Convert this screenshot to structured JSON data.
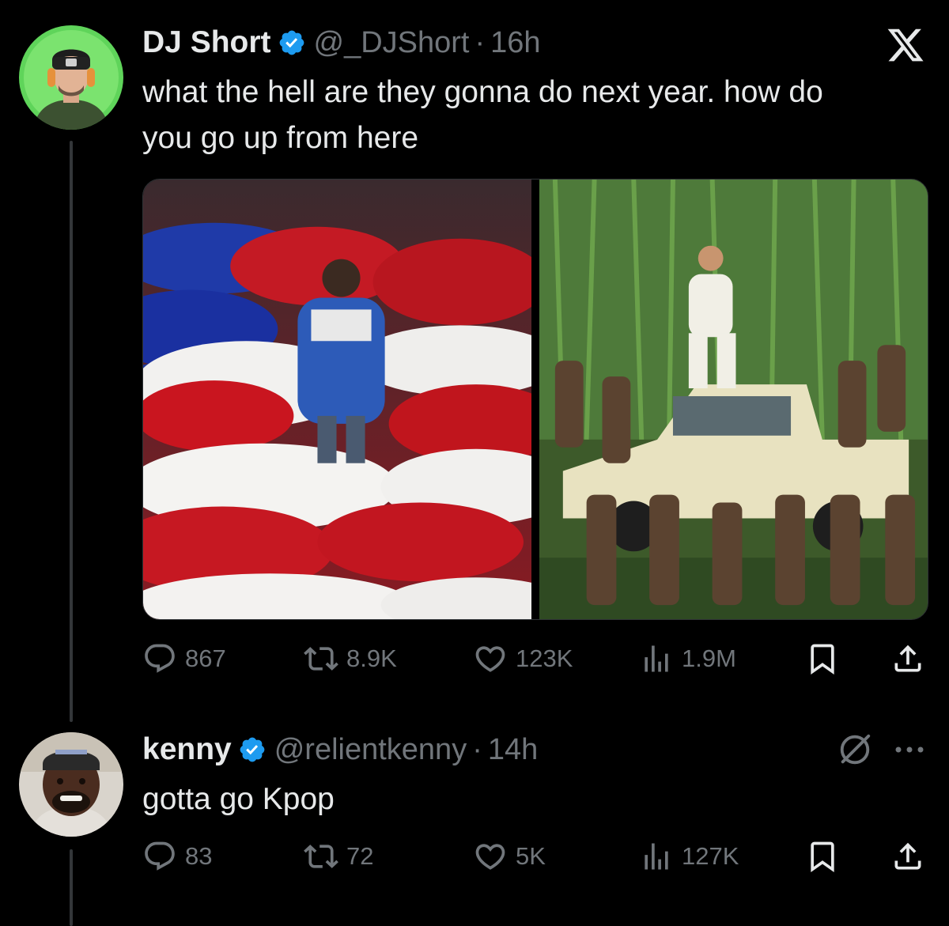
{
  "tweet": {
    "name": "DJ Short",
    "handle": "@_DJShort",
    "separator": "·",
    "time": "16h",
    "text_line1": "what the hell are they gonna do next year. how do",
    "text_line2": "you go up from here",
    "media": [
      {
        "icon": "photo-stage-performers-red-white-blue"
      },
      {
        "icon": "photo-dancers-on-truck-cornfield"
      }
    ],
    "stats": {
      "replies": "867",
      "reposts": "8.9K",
      "likes": "123K",
      "views": "1.9M"
    }
  },
  "reply": {
    "name": "kenny",
    "handle": "@relientkenny",
    "separator": "·",
    "time": "14h",
    "text": "gotta go Kpop",
    "stats": {
      "replies": "83",
      "reposts": "72",
      "likes": "5K",
      "views": "127K"
    }
  },
  "colors": {
    "background": "#000000",
    "text": "#e7e9ea",
    "secondary": "#71767b",
    "verified": "#1d9bf0",
    "thread_line": "#333639"
  },
  "icons": [
    "x-logo-icon",
    "verified-badge-icon",
    "reply-icon",
    "repost-icon",
    "like-icon",
    "views-icon",
    "bookmark-icon",
    "share-icon",
    "grok-icon",
    "more-icon"
  ]
}
